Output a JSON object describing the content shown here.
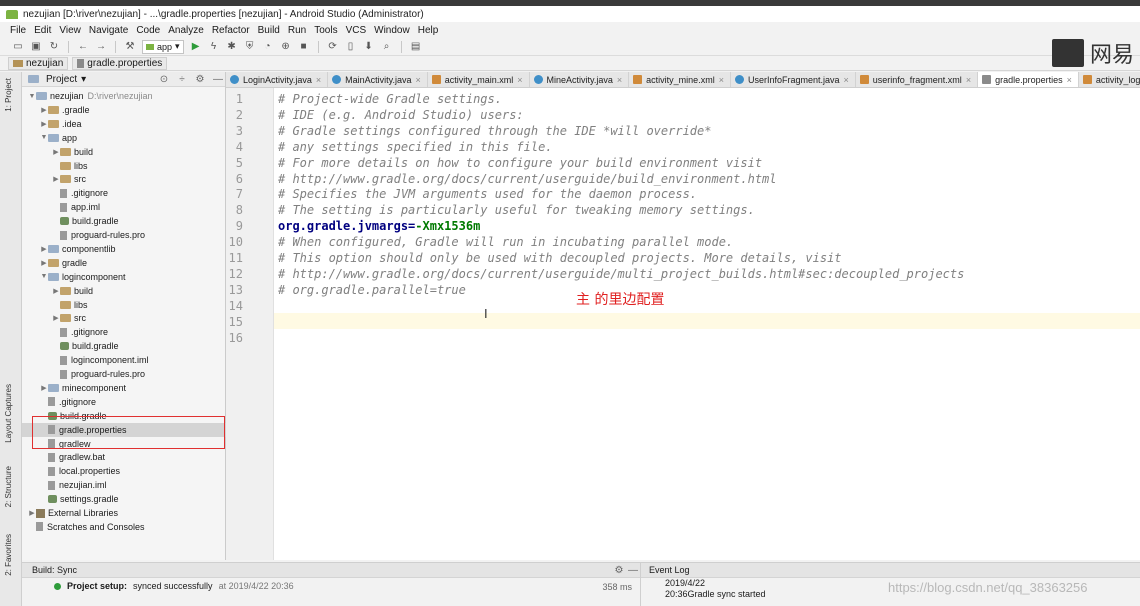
{
  "window": {
    "title": "nezujian [D:\\river\\nezujian] - ...\\gradle.properties [nezujian] - Android Studio (Administrator)"
  },
  "menu": [
    "File",
    "Edit",
    "View",
    "Navigate",
    "Code",
    "Analyze",
    "Refactor",
    "Build",
    "Run",
    "Tools",
    "VCS",
    "Window",
    "Help"
  ],
  "toolbar": {
    "run_config": "app"
  },
  "breadcrumb": [
    "nezujian",
    "gradle.properties"
  ],
  "sidebar_tabs": {
    "project": "1: Project",
    "captures": "Layout Captures",
    "structure": "2: Structure",
    "favorites": "2: Favorites"
  },
  "project_panel": {
    "header": "Project",
    "tree": [
      {
        "label": "nezujian",
        "extra": "D:\\river\\nezujian",
        "indent": 0,
        "arrow": "▼",
        "icon": "folder-mod"
      },
      {
        "label": ".gradle",
        "indent": 1,
        "arrow": "▶",
        "icon": "folder"
      },
      {
        "label": ".idea",
        "indent": 1,
        "arrow": "▶",
        "icon": "folder"
      },
      {
        "label": "app",
        "indent": 1,
        "arrow": "▼",
        "icon": "folder-mod"
      },
      {
        "label": "build",
        "indent": 2,
        "arrow": "▶",
        "icon": "folder"
      },
      {
        "label": "libs",
        "indent": 2,
        "arrow": "",
        "icon": "folder"
      },
      {
        "label": "src",
        "indent": 2,
        "arrow": "▶",
        "icon": "folder"
      },
      {
        "label": ".gitignore",
        "indent": 2,
        "arrow": "",
        "icon": "file"
      },
      {
        "label": "app.iml",
        "indent": 2,
        "arrow": "",
        "icon": "file"
      },
      {
        "label": "build.gradle",
        "indent": 2,
        "arrow": "",
        "icon": "gradle"
      },
      {
        "label": "proguard-rules.pro",
        "indent": 2,
        "arrow": "",
        "icon": "file"
      },
      {
        "label": "componentlib",
        "indent": 1,
        "arrow": "▶",
        "icon": "folder-mod"
      },
      {
        "label": "gradle",
        "indent": 1,
        "arrow": "▶",
        "icon": "folder"
      },
      {
        "label": "logincomponent",
        "indent": 1,
        "arrow": "▼",
        "icon": "folder-mod"
      },
      {
        "label": "build",
        "indent": 2,
        "arrow": "▶",
        "icon": "folder"
      },
      {
        "label": "libs",
        "indent": 2,
        "arrow": "",
        "icon": "folder"
      },
      {
        "label": "src",
        "indent": 2,
        "arrow": "▶",
        "icon": "folder"
      },
      {
        "label": ".gitignore",
        "indent": 2,
        "arrow": "",
        "icon": "file"
      },
      {
        "label": "build.gradle",
        "indent": 2,
        "arrow": "",
        "icon": "gradle"
      },
      {
        "label": "logincomponent.iml",
        "indent": 2,
        "arrow": "",
        "icon": "file"
      },
      {
        "label": "proguard-rules.pro",
        "indent": 2,
        "arrow": "",
        "icon": "file"
      },
      {
        "label": "minecomponent",
        "indent": 1,
        "arrow": "▶",
        "icon": "folder-mod"
      },
      {
        "label": ".gitignore",
        "indent": 1,
        "arrow": "",
        "icon": "file"
      },
      {
        "label": "build.gradle",
        "indent": 1,
        "arrow": "",
        "icon": "gradle"
      },
      {
        "label": "gradle.properties",
        "indent": 1,
        "arrow": "",
        "icon": "file",
        "selected": true
      },
      {
        "label": "gradlew",
        "indent": 1,
        "arrow": "",
        "icon": "file"
      },
      {
        "label": "gradlew.bat",
        "indent": 1,
        "arrow": "",
        "icon": "file"
      },
      {
        "label": "local.properties",
        "indent": 1,
        "arrow": "",
        "icon": "file"
      },
      {
        "label": "nezujian.iml",
        "indent": 1,
        "arrow": "",
        "icon": "file"
      },
      {
        "label": "settings.gradle",
        "indent": 1,
        "arrow": "",
        "icon": "gradle"
      },
      {
        "label": "External Libraries",
        "indent": 0,
        "arrow": "▶",
        "icon": "lib"
      },
      {
        "label": "Scratches and Consoles",
        "indent": 0,
        "arrow": "",
        "icon": "file"
      }
    ]
  },
  "editor_tabs": [
    {
      "label": "LoginActivity.java",
      "kind": "java"
    },
    {
      "label": "MainActivity.java",
      "kind": "java"
    },
    {
      "label": "activity_main.xml",
      "kind": "xml"
    },
    {
      "label": "MineActivity.java",
      "kind": "java"
    },
    {
      "label": "activity_mine.xml",
      "kind": "xml"
    },
    {
      "label": "UserInfoFragment.java",
      "kind": "java"
    },
    {
      "label": "userinfo_fragment.xml",
      "kind": "xml"
    },
    {
      "label": "gradle.properties",
      "kind": "prop",
      "active": true
    },
    {
      "label": "activity_login.xml",
      "kind": "xml"
    }
  ],
  "editor": {
    "lines": [
      {
        "n": "1",
        "text": "# Project-wide Gradle settings.",
        "kind": "comment"
      },
      {
        "n": "2",
        "text": "# IDE (e.g. Android Studio) users:",
        "kind": "comment"
      },
      {
        "n": "3",
        "text": "# Gradle settings configured through the IDE *will override*",
        "kind": "comment"
      },
      {
        "n": "4",
        "text": "# any settings specified in this file.",
        "kind": "comment"
      },
      {
        "n": "5",
        "text": "# For more details on how to configure your build environment visit",
        "kind": "comment"
      },
      {
        "n": "6",
        "text": "# http://www.gradle.org/docs/current/userguide/build_environment.html",
        "kind": "comment"
      },
      {
        "n": "7",
        "text": "# Specifies the JVM arguments used for the daemon process.",
        "kind": "comment"
      },
      {
        "n": "8",
        "text": "# The setting is particularly useful for tweaking memory settings.",
        "kind": "comment"
      },
      {
        "n": "9",
        "key": "org.gradle.jvmargs=",
        "value": "-Xmx1536m",
        "kind": "key"
      },
      {
        "n": "10",
        "text": "# When configured, Gradle will run in incubating parallel mode.",
        "kind": "comment"
      },
      {
        "n": "11",
        "text": "# This option should only be used with decoupled projects. More details, visit",
        "kind": "comment"
      },
      {
        "n": "12",
        "text": "# http://www.gradle.org/docs/current/userguide/multi_project_builds.html#sec:decoupled_projects",
        "kind": "comment"
      },
      {
        "n": "13",
        "text": "# org.gradle.parallel=true",
        "kind": "comment"
      },
      {
        "n": "14",
        "text": "",
        "kind": "blank"
      },
      {
        "n": "15",
        "text": "",
        "kind": "blank"
      },
      {
        "n": "16",
        "text": "",
        "kind": "blank"
      }
    ],
    "annotation": "主 的里边配置"
  },
  "build_panel": {
    "tab": "Build: Sync",
    "status_bold": "Project setup:",
    "status_text": "synced successfully",
    "timestamp": "at 2019/4/22 20:36",
    "duration": "358 ms"
  },
  "event_log": {
    "tab": "Event Log",
    "date": "2019/4/22",
    "message": "20:36Gradle sync started"
  },
  "watermark": {
    "logo_text": "网易",
    "url": "https://blog.csdn.net/qq_38363256"
  }
}
